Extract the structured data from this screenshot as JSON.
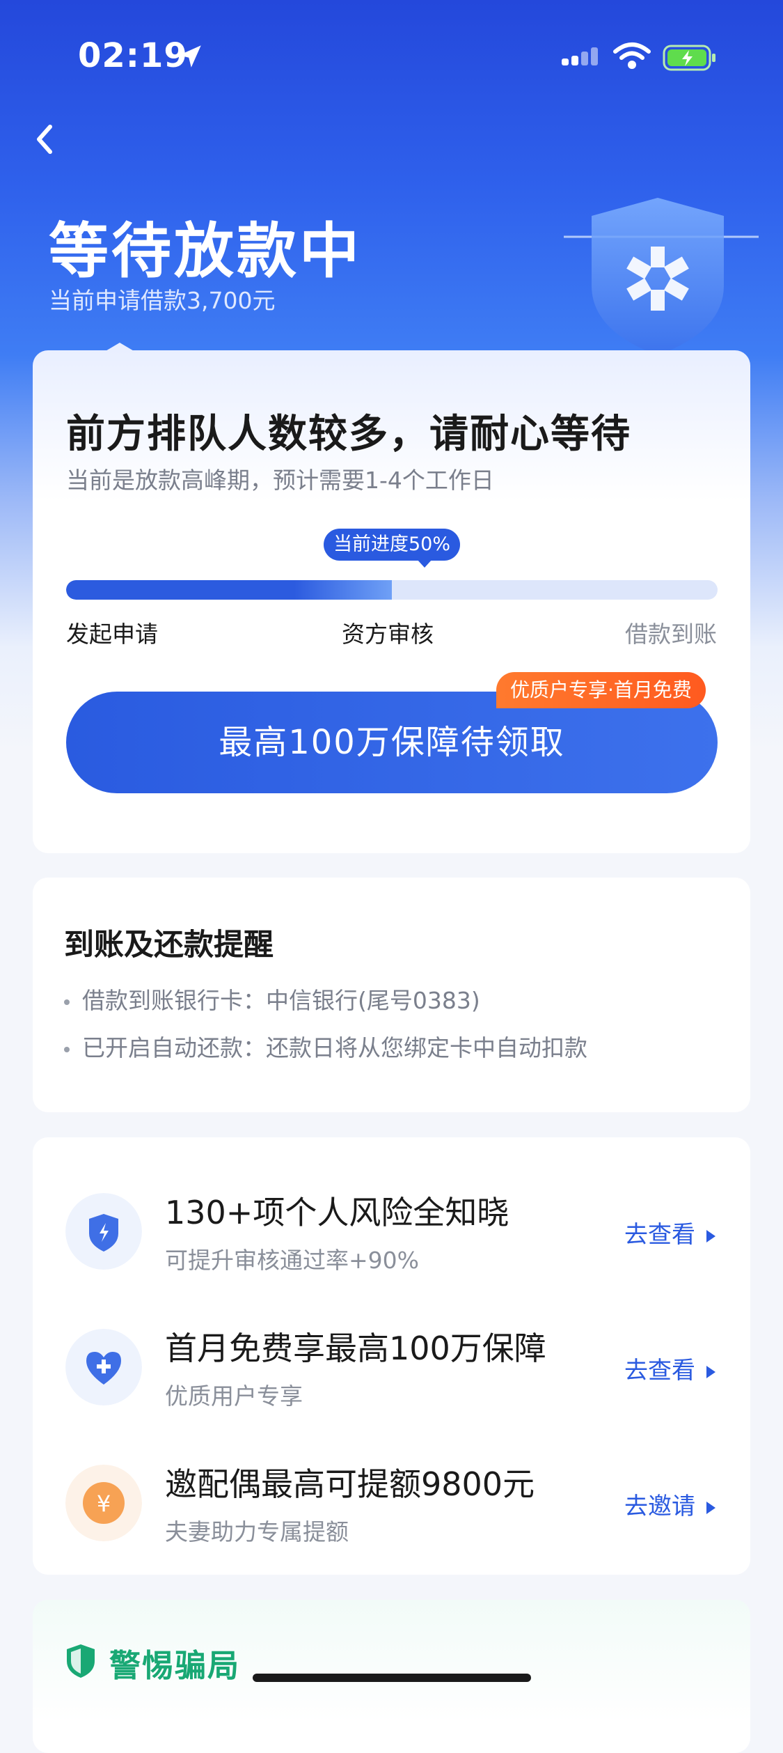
{
  "status_bar": {
    "time": "02:19"
  },
  "header": {
    "title": "等待放款中",
    "subtitle": "当前申请借款3,700元"
  },
  "progress_card": {
    "heading": "前方排队人数较多，请耐心等待",
    "subheading": "当前是放款高峰期，预计需要1-4个工作日",
    "progress_label": "当前进度50%",
    "progress_fraction": 0.5,
    "steps": [
      "发起申请",
      "资方审核",
      "借款到账"
    ],
    "cta_label": "最高100万保障待领取",
    "cta_tag": "优质户专享·首月免费"
  },
  "reminder_card": {
    "heading": "到账及还款提醒",
    "lines": [
      "借款到账银行卡：中信银行(尾号0383)",
      "已开启自动还款：还款日将从您绑定卡中自动扣款"
    ]
  },
  "offers": [
    {
      "title": "130+项个人风险全知晓",
      "subtitle": "可提升审核通过率+90%",
      "action": "去查看",
      "icon": "shield-bolt-icon"
    },
    {
      "title": "首月免费享最高100万保障",
      "subtitle": "优质用户专享",
      "action": "去查看",
      "icon": "heart-plus-icon"
    },
    {
      "title": "邀配偶最高可提额9800元",
      "subtitle": "夫妻助力专属提额",
      "action": "去邀请",
      "icon": "yen-coin-icon"
    }
  ],
  "fraud_card": {
    "heading": "警惕骗局"
  },
  "colors": {
    "primary": "#2a5ae0",
    "accent_orange": "#ff6a26",
    "green": "#19a874"
  }
}
